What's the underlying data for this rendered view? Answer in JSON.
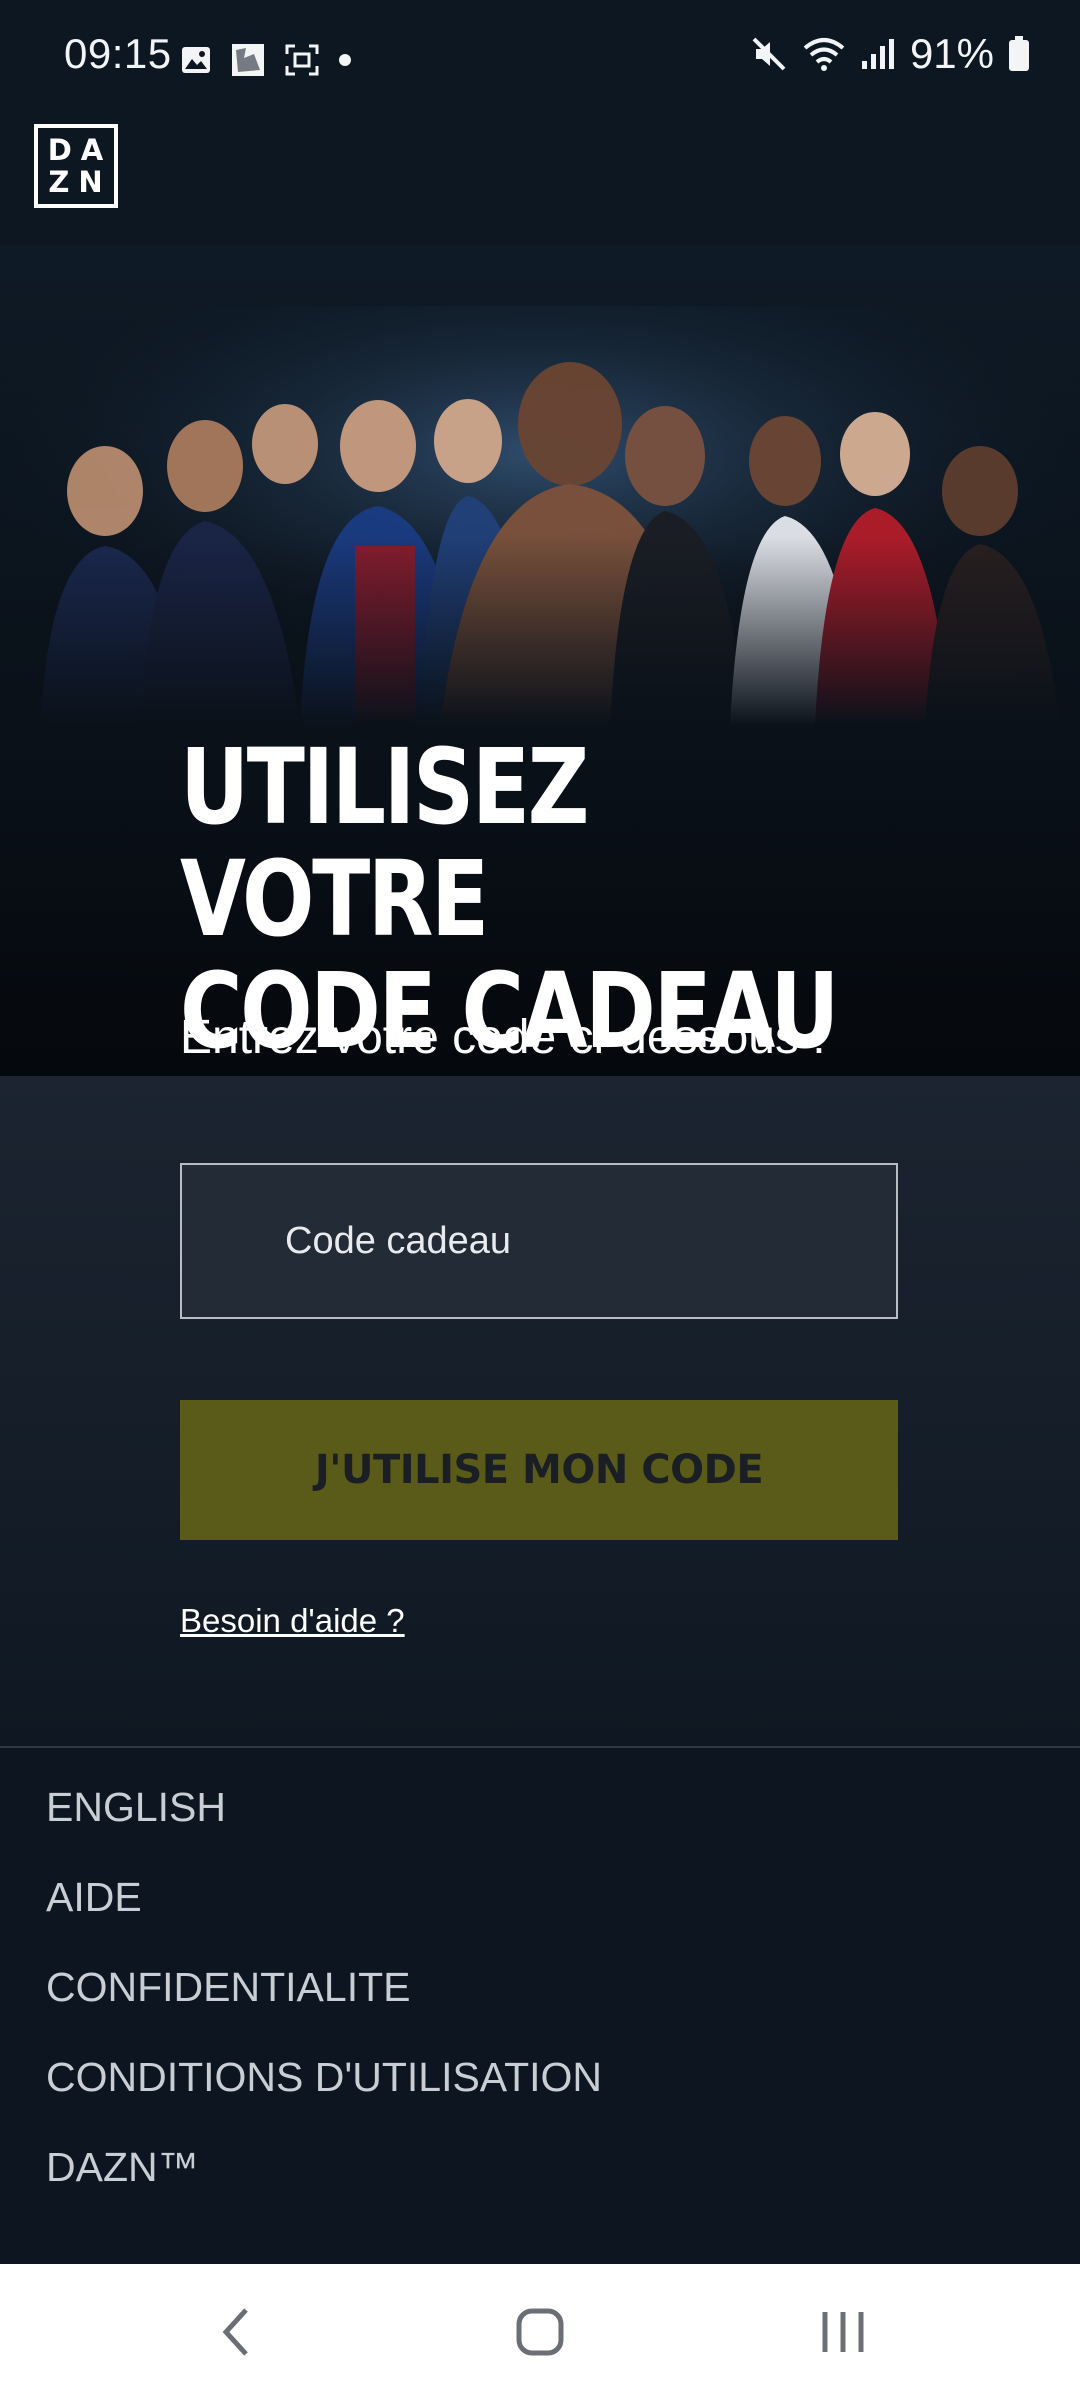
{
  "status_bar": {
    "time": "09:15",
    "battery": "91%",
    "left_icons": [
      "image-icon",
      "gallery-icon",
      "screenshot-icon",
      "dot-icon"
    ],
    "right_icons": [
      "mute-icon",
      "wifi-icon",
      "signal-icon",
      "battery-icon"
    ]
  },
  "header": {
    "logo_line1": "DA",
    "logo_line2": "ZN"
  },
  "hero": {
    "title_line1": "UTILISEZ VOTRE",
    "title_line2": "CODE CADEAU",
    "subtitle": "Entrez votre code ci-dessous :"
  },
  "form": {
    "input_placeholder": "Code cadeau",
    "input_value": "",
    "submit_label": "J'UTILISE MON CODE",
    "help_link": "Besoin d'aide ?"
  },
  "footer": {
    "links": [
      "ENGLISH",
      "AIDE",
      "CONFIDENTIALITE",
      "CONDITIONS D'UTILISATION",
      "DAZN™"
    ]
  },
  "colors": {
    "background": "#0c1520",
    "button": "#5b5b19",
    "button_text": "#1a1f26"
  }
}
